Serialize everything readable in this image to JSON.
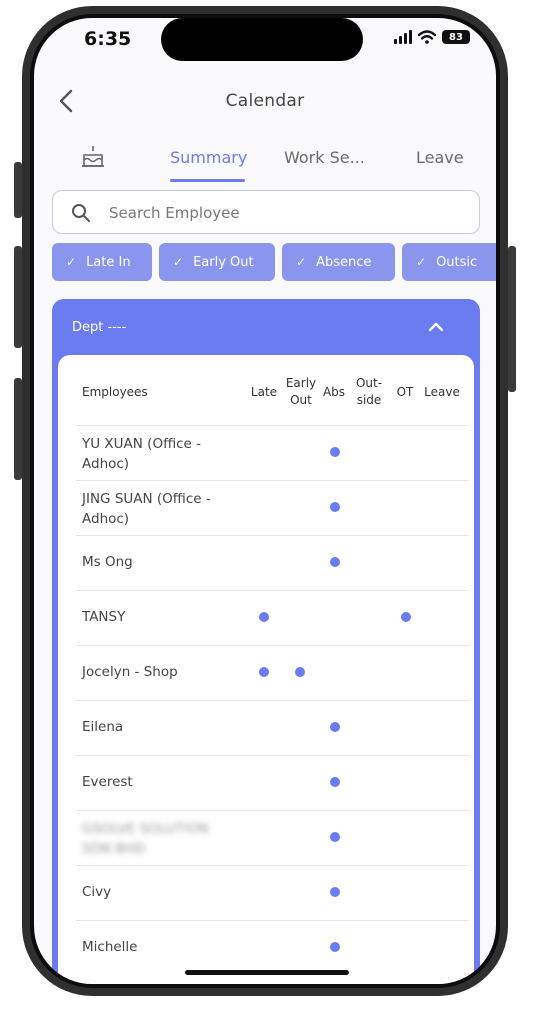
{
  "status_bar": {
    "time": "6:35",
    "battery": "83"
  },
  "header": {
    "title": "Calendar"
  },
  "tabs": [
    {
      "label": "Summary",
      "active": true
    },
    {
      "label": "Work Se..."
    },
    {
      "label": "Leave"
    }
  ],
  "search": {
    "placeholder": "Search Employee"
  },
  "filters": [
    "Late In",
    "Early Out",
    "Absence",
    "Outsic"
  ],
  "dept": {
    "title": "Dept ----"
  },
  "table": {
    "headers": {
      "employees": "Employees",
      "late": "Late",
      "early_out": "Early\nOut",
      "abs": "Abs",
      "outside": "Out-\nside",
      "ot": "OT",
      "leave": "Leave"
    },
    "rows": [
      {
        "name": "YU XUAN (Office - Adhoc)",
        "late": false,
        "early_out": false,
        "abs": true,
        "ot": false
      },
      {
        "name": "JING SUAN (Office - Adhoc)",
        "late": false,
        "early_out": false,
        "abs": true,
        "ot": false
      },
      {
        "name": "Ms Ong",
        "late": false,
        "early_out": false,
        "abs": true,
        "ot": false
      },
      {
        "name": "TANSY",
        "late": true,
        "early_out": false,
        "abs": false,
        "ot": true
      },
      {
        "name": "Jocelyn - Shop",
        "late": true,
        "early_out": true,
        "abs": false,
        "ot": false
      },
      {
        "name": "Eilena",
        "late": false,
        "early_out": false,
        "abs": true,
        "ot": false
      },
      {
        "name": "Everest",
        "late": false,
        "early_out": false,
        "abs": true,
        "ot": false
      },
      {
        "name": "GSOLVE SOLUTION SDN BHD",
        "late": false,
        "early_out": false,
        "abs": true,
        "ot": false,
        "blurred": true
      },
      {
        "name": "Civy",
        "late": false,
        "early_out": false,
        "abs": true,
        "ot": false
      },
      {
        "name": "Michelle",
        "late": false,
        "early_out": false,
        "abs": true,
        "ot": false
      }
    ]
  },
  "colors": {
    "accent": "#6b7bf0",
    "chip": "#8a95ee"
  }
}
